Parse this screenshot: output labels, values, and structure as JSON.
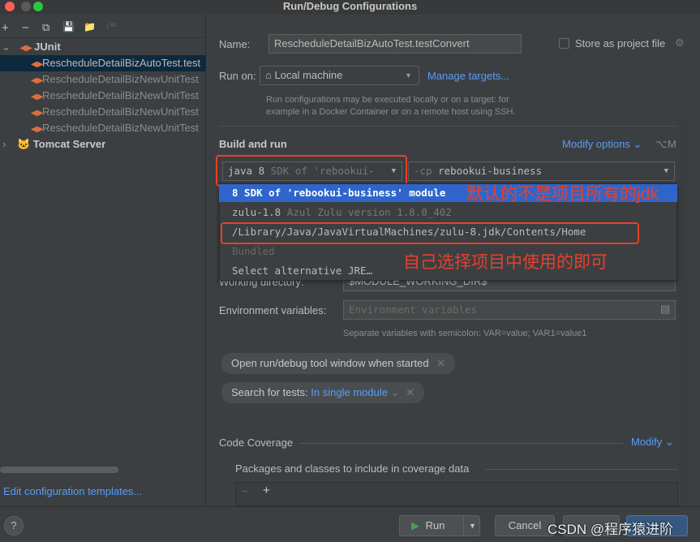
{
  "window": {
    "title": "Run/Debug Configurations"
  },
  "toolbar": {
    "add": "+",
    "remove": "−",
    "copy": "⧉",
    "save": "💾",
    "folder": "📁",
    "sort": "↓ᵃᶻ"
  },
  "tree": {
    "junit_label": "JUnit",
    "items": [
      "RescheduleDetailBizAutoTest.test",
      "RescheduleDetailBizNewUnitTest",
      "RescheduleDetailBizNewUnitTest",
      "RescheduleDetailBizNewUnitTest",
      "RescheduleDetailBizNewUnitTest"
    ],
    "tomcat_label": "Tomcat Server"
  },
  "edit_templates": "Edit configuration templates...",
  "form": {
    "name_label": "Name:",
    "name_value": "RescheduleDetailBizAutoTest.testConvert",
    "store_label": "Store as project file",
    "run_on_label": "Run on:",
    "run_on_value": "Local machine",
    "manage_targets": "Manage targets...",
    "run_on_hint1": "Run configurations may be executed locally or on a target: for",
    "run_on_hint2": "example in a Docker Container or on a remote host using SSH.",
    "build_and_run": "Build and run",
    "modify_options": "Modify options",
    "modify_shortcut": "⌥M",
    "jre_value": "java 8",
    "jre_hint": "SDK of 'rebookui-",
    "cp_prefix": "-cp",
    "cp_value": "rebookui-business",
    "working_dir_label": "Working directory:",
    "working_dir_value": "$MODULE_WORKING_DIR$",
    "env_label": "Environment variables:",
    "env_placeholder": "Environment variables",
    "env_hint": "Separate variables with semicolon: VAR=value; VAR1=value1",
    "chip_open": "Open run/debug tool window when started",
    "chip_search_label": "Search for tests:",
    "chip_search_value": "In single module",
    "code_coverage": "Code Coverage",
    "modify": "Modify",
    "packages_label": "Packages and classes to include in coverage data"
  },
  "dropdown": {
    "items": [
      {
        "main": "8 SDK of 'rebookui-business' module",
        "sub": ""
      },
      {
        "main": "zulu-1.8",
        "sub": "Azul Zulu version 1.8.0_402"
      },
      {
        "main": "/Library/Java/JavaVirtualMachines/zulu-8.jdk/Contents/Home",
        "sub": ""
      },
      {
        "main": "Bundled",
        "sub": ""
      },
      {
        "main": "Select alternative JRE…",
        "sub": ""
      }
    ]
  },
  "annotations": {
    "default_note": "默认的不是项目所有的jdk",
    "choose_note": "自己选择项目中使用的即可"
  },
  "footer": {
    "help": "?",
    "run": "Run",
    "cancel": "Cancel",
    "watermark": "CSDN @程序猿进阶"
  },
  "colors": {
    "accent": "#589df6",
    "selection": "#2f65ca",
    "annotation": "#e8402a"
  }
}
